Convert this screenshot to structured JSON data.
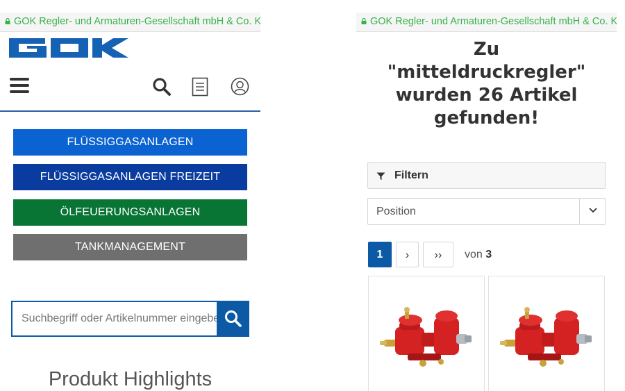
{
  "browser": {
    "url_text": "GOK Regler- und Armaturen-Gesellschaft mbH & Co. KG"
  },
  "left": {
    "logo_text": "GOK",
    "categories": [
      {
        "label": "FLÜSSIGGASANLAGEN",
        "color": "#0b63d1"
      },
      {
        "label": "FLÜSSIGGASANLAGEN FREIZEIT",
        "color": "#0a3ca0"
      },
      {
        "label": "ÖLFEUERUNGSANLAGEN",
        "color": "#087535"
      },
      {
        "label": "TANKMANAGEMENT",
        "color": "#6f6f6f"
      }
    ],
    "search": {
      "placeholder": "Suchbegriff oder Artikelnummer eingeben"
    },
    "section_title": "Produkt Highlights"
  },
  "right": {
    "result_title": "Zu \"mitteldruckregler\" wurden 26 Artikel gefunden!",
    "filter_label": "Filtern",
    "sort_value": "Position",
    "pagination": {
      "current": "1",
      "next_label": "›",
      "last_label": "››",
      "of_label": "von",
      "total": "3"
    }
  },
  "colors": {
    "brand_blue": "#0c5aa6",
    "secure_green": "#36b24a"
  }
}
